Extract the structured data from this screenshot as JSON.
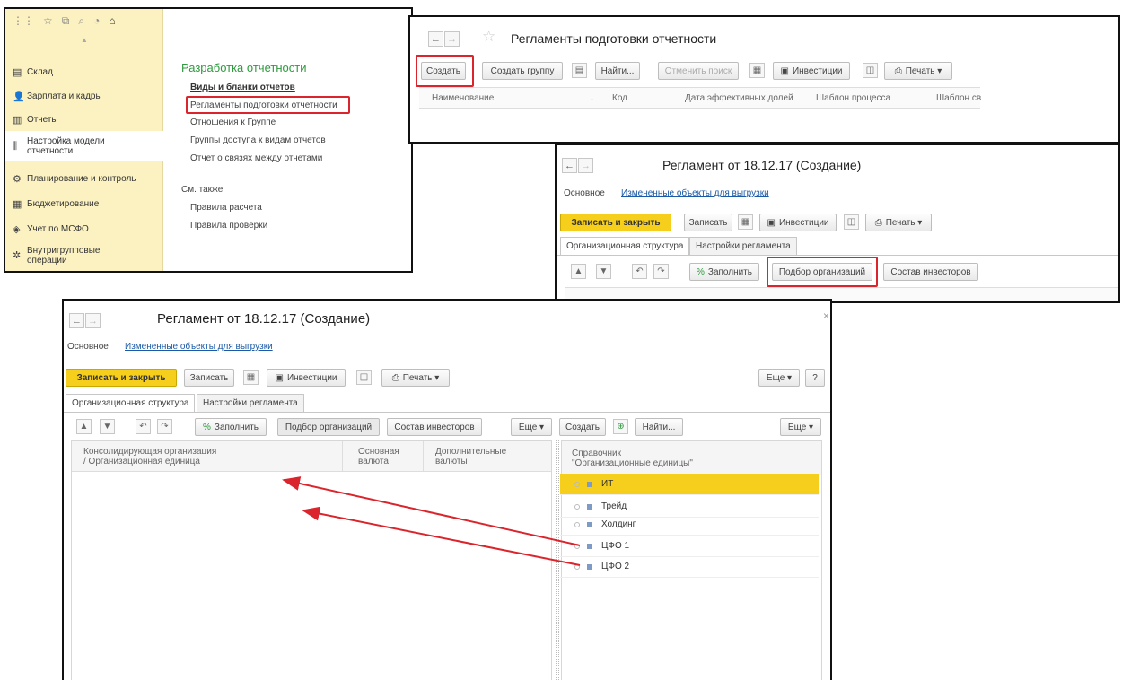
{
  "win1": {
    "toolbar_icons": [
      "grid-icon",
      "star-icon",
      "history-icon",
      "search-icon",
      "bell-icon",
      "home-icon"
    ],
    "sidebar": [
      {
        "label": "Склад",
        "icon": "▤"
      },
      {
        "label": "Зарплата и кадры",
        "icon": "👤"
      },
      {
        "label": "Отчеты",
        "icon": "▥"
      },
      {
        "label": "Настройка модели отчетности",
        "icon": "⫼"
      },
      {
        "label": "Планирование и контроль",
        "icon": "⚙"
      },
      {
        "label": "Бюджетирование",
        "icon": "▦"
      },
      {
        "label": "Учет по МСФО",
        "icon": "◈"
      },
      {
        "label": "Внутригрупповые операции",
        "icon": "✲"
      }
    ],
    "section_title": "Разработка отчетности",
    "menu": [
      "Виды и бланки отчетов",
      "Регламенты подготовки отчетности",
      "Отношения к Группе",
      "Группы доступа к видам отчетов",
      "Отчет о связях между отчетами"
    ],
    "see_also": "См. также",
    "see_also_items": [
      "Правила расчета",
      "Правила проверки"
    ]
  },
  "win2": {
    "title": "Регламенты подготовки отчетности",
    "buttons": {
      "create": "Создать",
      "create_group": "Создать группу",
      "find": "Найти...",
      "cancel_search": "Отменить поиск",
      "investments": "Инвестиции",
      "print": "Печать ▾"
    },
    "columns": [
      "Наименование",
      "↓",
      "Код",
      "Дата эффективных долей",
      "Шаблон процесса",
      "Шаблон св"
    ]
  },
  "win3": {
    "title": "Регламент от 18.12.17 (Создание)",
    "nav_main": "Основное",
    "nav_link": "Измененные объекты для выгрузки",
    "buttons": {
      "save_close": "Записать и закрыть",
      "save": "Записать",
      "investments": "Инвестиции",
      "print": "Печать ▾",
      "fill": "Заполнить",
      "select_orgs": "Подбор организаций",
      "investors": "Состав инвесторов"
    },
    "tabs": [
      "Организационная структура",
      "Настройки регламента"
    ]
  },
  "win4": {
    "title": "Регламент от 18.12.17 (Создание)",
    "close": "×",
    "nav_main": "Основное",
    "nav_link": "Измененные объекты для выгрузки",
    "buttons": {
      "save_close": "Записать и закрыть",
      "save": "Записать",
      "investments": "Инвестиции",
      "print": "Печать ▾",
      "more": "Еще ▾",
      "help": "?",
      "fill": "Заполнить",
      "select_orgs": "Подбор организаций",
      "investors": "Состав инвесторов",
      "more2": "Еще ▾",
      "create": "Создать",
      "find": "Найти...",
      "more3": "Еще ▾"
    },
    "tabs": [
      "Организационная структура",
      "Настройки регламента"
    ],
    "left_columns": {
      "c1": "Консолидирующая организация\n/ Организационная единица",
      "c2": "Основная\nвалюта",
      "c3": "Дополнительные\nвалюты"
    },
    "right_header": "Справочник\n\"Организационные единицы\"",
    "units": [
      "ИТ",
      "Трейд",
      "Холдинг",
      "ЦФО 1",
      "ЦФО 2"
    ]
  },
  "colors": {
    "accent_yellow": "#f6cf1d",
    "highlight_red": "#d9252b",
    "sidebar_bg": "#fbf1c1",
    "link_blue": "#1b5aa7"
  }
}
